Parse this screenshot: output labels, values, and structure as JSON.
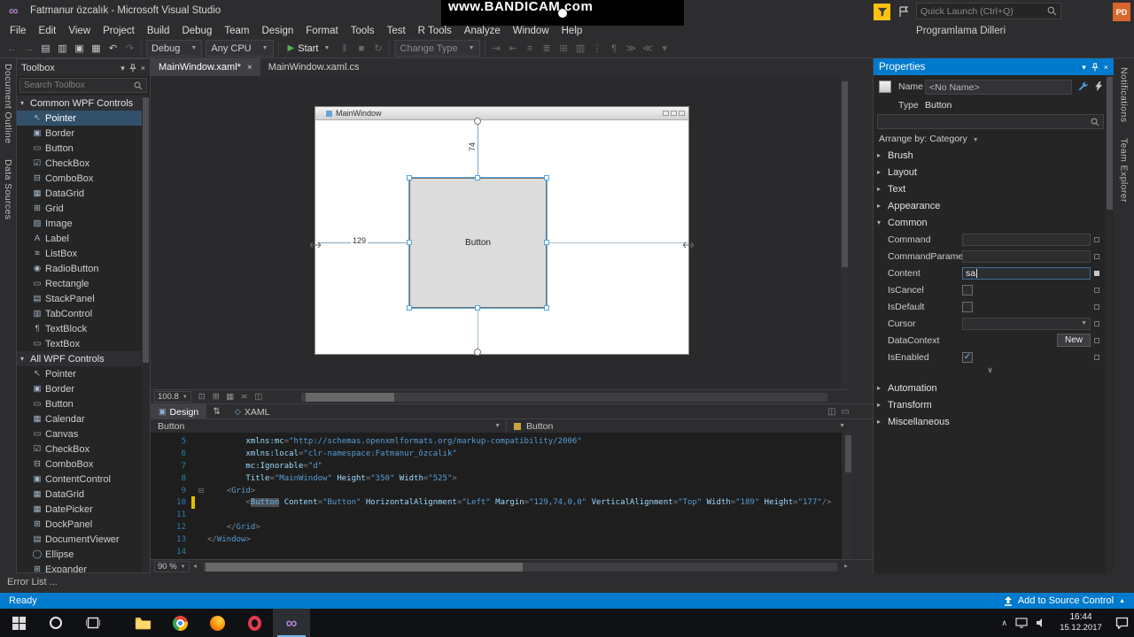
{
  "watermark": {
    "text": "www.BANDICAM.com"
  },
  "titlebar": {
    "title": "Fatmanur özcalık - Microsoft Visual Studio",
    "quick_launch_placeholder": "Quick Launch (Ctrl+Q)",
    "account_name": "Programlama Dilleri",
    "avatar_initials": "PD"
  },
  "menubar": {
    "items": [
      "File",
      "Edit",
      "View",
      "Project",
      "Build",
      "Debug",
      "Team",
      "Design",
      "Format",
      "Tools",
      "Test",
      "R Tools",
      "Analyze",
      "Window",
      "Help"
    ]
  },
  "toolbar": {
    "groups_a": [
      {
        "name": "nav-back-icon",
        "glyph": "←",
        "dim": true
      },
      {
        "name": "nav-forward-icon",
        "glyph": "→",
        "dim": true
      },
      {
        "name": "new-file-icon",
        "glyph": "▤",
        "dim": false
      },
      {
        "name": "open-file-icon",
        "glyph": "▥",
        "dim": false
      },
      {
        "name": "save-icon",
        "glyph": "▣",
        "dim": false
      },
      {
        "name": "save-all-icon",
        "glyph": "▦",
        "dim": false
      },
      {
        "name": "undo-icon",
        "glyph": "↶",
        "dim": false
      },
      {
        "name": "redo-icon",
        "glyph": "↷",
        "dim": true
      }
    ],
    "debug_target": "Debug",
    "platform": "Any CPU",
    "start_label": "Start",
    "groups_b": [
      {
        "name": "pause-icon",
        "glyph": "‖",
        "dim": true
      },
      {
        "name": "stop-icon",
        "glyph": "■",
        "dim": true
      },
      {
        "name": "restart-icon",
        "glyph": "↻",
        "dim": true
      }
    ],
    "change_type_label": "Change Type",
    "groups_c": [
      {
        "name": "step-into-icon",
        "glyph": "⇥",
        "dim": true
      },
      {
        "name": "step-out-icon",
        "glyph": "⇤",
        "dim": true
      },
      {
        "name": "align-lines-icon",
        "glyph": "≡",
        "dim": true
      },
      {
        "name": "align-blocks-icon",
        "glyph": "≣",
        "dim": true
      },
      {
        "name": "grid-toggle-icon",
        "glyph": "⊞",
        "dim": true
      },
      {
        "name": "columns-icon",
        "glyph": "▥",
        "dim": true
      },
      {
        "name": "list-members-icon",
        "glyph": "⋮",
        "dim": true
      },
      {
        "name": "comment-icon",
        "glyph": "¶",
        "dim": true
      },
      {
        "name": "indent-icon",
        "glyph": "≫",
        "dim": true
      },
      {
        "name": "outdent-icon",
        "glyph": "≪",
        "dim": true
      },
      {
        "name": "overflow-icon",
        "glyph": "▾",
        "dim": true
      }
    ]
  },
  "side_tabs_left": [
    "Document Outline",
    "Data Sources"
  ],
  "side_tabs_right": [
    "Notifications",
    "Team Explorer"
  ],
  "toolbox": {
    "title": "Toolbox",
    "search_placeholder": "Search Toolbox",
    "groups": [
      {
        "label": "Common WPF Controls",
        "items": [
          {
            "label": "Pointer",
            "icon": "↖",
            "selected": true
          },
          {
            "label": "Border",
            "icon": "▣"
          },
          {
            "label": "Button",
            "icon": "▭"
          },
          {
            "label": "CheckBox",
            "icon": "☑"
          },
          {
            "label": "ComboBox",
            "icon": "⊟"
          },
          {
            "label": "DataGrid",
            "icon": "▦"
          },
          {
            "label": "Grid",
            "icon": "⊞"
          },
          {
            "label": "Image",
            "icon": "▨"
          },
          {
            "label": "Label",
            "icon": "A"
          },
          {
            "label": "ListBox",
            "icon": "≡"
          },
          {
            "label": "RadioButton",
            "icon": "◉"
          },
          {
            "label": "Rectangle",
            "icon": "▭"
          },
          {
            "label": "StackPanel",
            "icon": "▤"
          },
          {
            "label": "TabControl",
            "icon": "▥"
          },
          {
            "label": "TextBlock",
            "icon": "¶"
          },
          {
            "label": "TextBox",
            "icon": "▭"
          }
        ]
      },
      {
        "label": "All WPF Controls",
        "items": [
          {
            "label": "Pointer",
            "icon": "↖"
          },
          {
            "label": "Border",
            "icon": "▣"
          },
          {
            "label": "Button",
            "icon": "▭"
          },
          {
            "label": "Calendar",
            "icon": "▦"
          },
          {
            "label": "Canvas",
            "icon": "▭"
          },
          {
            "label": "CheckBox",
            "icon": "☑"
          },
          {
            "label": "ComboBox",
            "icon": "⊟"
          },
          {
            "label": "ContentControl",
            "icon": "▣"
          },
          {
            "label": "DataGrid",
            "icon": "▦"
          },
          {
            "label": "DatePicker",
            "icon": "▦"
          },
          {
            "label": "DockPanel",
            "icon": "⊞"
          },
          {
            "label": "DocumentViewer",
            "icon": "▤"
          },
          {
            "label": "Ellipse",
            "icon": "◯"
          },
          {
            "label": "Expander",
            "icon": "⊞"
          }
        ]
      }
    ]
  },
  "doc_tabs": {
    "tab1": "MainWindow.xaml*",
    "tab2": "MainWindow.xaml.cs"
  },
  "designer": {
    "window_title": "MainWindow",
    "button_text": "Button",
    "dim_left": "129",
    "dim_top": "74",
    "zoom": "100.8",
    "bar_icons": [
      {
        "name": "zoom-fit-icon",
        "glyph": "⊡"
      },
      {
        "name": "show-grid-icon",
        "glyph": "⊞"
      },
      {
        "name": "snap-grid-icon",
        "glyph": "▦"
      },
      {
        "name": "snaplines-icon",
        "glyph": "≍"
      },
      {
        "name": "show-handles-icon",
        "glyph": "◫"
      }
    ]
  },
  "split": {
    "design": "Design",
    "xaml": "XAML"
  },
  "breadcrumb": {
    "left": "Button",
    "right": "Button"
  },
  "code": {
    "zoom": "90 %",
    "lines": [
      {
        "no": "5",
        "segs": [
          [
            "t",
            "        "
          ],
          [
            "a",
            "xmlns:mc"
          ],
          [
            "p",
            "="
          ],
          [
            "v",
            "\"http://schemas.openxmlformats.org/markup-compatibility/2006\""
          ]
        ]
      },
      {
        "no": "6",
        "segs": [
          [
            "t",
            "        "
          ],
          [
            "a",
            "xmlns:local"
          ],
          [
            "p",
            "="
          ],
          [
            "v",
            "\"clr-namespace:Fatmanur_özcalık\""
          ]
        ]
      },
      {
        "no": "7",
        "segs": [
          [
            "t",
            "        "
          ],
          [
            "a",
            "mc:Ignorable"
          ],
          [
            "p",
            "="
          ],
          [
            "v",
            "\"d\""
          ]
        ]
      },
      {
        "no": "8",
        "segs": [
          [
            "t",
            "        "
          ],
          [
            "a",
            "Title"
          ],
          [
            "p",
            "="
          ],
          [
            "v",
            "\"MainWindow\""
          ],
          [
            "t",
            " "
          ],
          [
            "a",
            "Height"
          ],
          [
            "p",
            "="
          ],
          [
            "v",
            "\"350\""
          ],
          [
            "t",
            " "
          ],
          [
            "a",
            "Width"
          ],
          [
            "p",
            "="
          ],
          [
            "v",
            "\"525\""
          ],
          [
            "p",
            ">"
          ]
        ]
      },
      {
        "no": "9",
        "fold": true,
        "segs": [
          [
            "t",
            "    "
          ],
          [
            "p",
            "<"
          ],
          [
            "e",
            "Grid"
          ],
          [
            "p",
            ">"
          ]
        ]
      },
      {
        "no": "10",
        "changed": true,
        "segs": [
          [
            "t",
            "        "
          ],
          [
            "p",
            "<"
          ],
          [
            "eh",
            "Button"
          ],
          [
            "t",
            " "
          ],
          [
            "a",
            "Content"
          ],
          [
            "p",
            "="
          ],
          [
            "v",
            "\"Button\""
          ],
          [
            "t",
            " "
          ],
          [
            "a",
            "HorizontalAlignment"
          ],
          [
            "p",
            "="
          ],
          [
            "v",
            "\"Left\""
          ],
          [
            "t",
            " "
          ],
          [
            "a",
            "Margin"
          ],
          [
            "p",
            "="
          ],
          [
            "v",
            "\"129,74,0,0\""
          ],
          [
            "t",
            " "
          ],
          [
            "a",
            "VerticalAlignment"
          ],
          [
            "p",
            "="
          ],
          [
            "v",
            "\"Top\""
          ],
          [
            "t",
            " "
          ],
          [
            "a",
            "Width"
          ],
          [
            "p",
            "="
          ],
          [
            "v",
            "\"189\""
          ],
          [
            "t",
            " "
          ],
          [
            "a",
            "Height"
          ],
          [
            "p",
            "="
          ],
          [
            "v",
            "\"177\""
          ],
          [
            "p",
            "/>"
          ]
        ]
      },
      {
        "no": "11",
        "segs": []
      },
      {
        "no": "12",
        "segs": [
          [
            "t",
            "    "
          ],
          [
            "p",
            "</"
          ],
          [
            "e",
            "Grid"
          ],
          [
            "p",
            ">"
          ]
        ]
      },
      {
        "no": "13",
        "segs": [
          [
            "p",
            "</"
          ],
          [
            "e",
            "Window"
          ],
          [
            "p",
            ">"
          ]
        ]
      },
      {
        "no": "14",
        "segs": []
      }
    ]
  },
  "properties": {
    "title": "Properties",
    "name_label": "Name",
    "name_value": "<No Name>",
    "type_label": "Type",
    "type_value": "Button",
    "arrange_label": "Arrange by: Category",
    "sections_top": [
      {
        "label": "Brush"
      },
      {
        "label": "Layout"
      },
      {
        "label": "Text"
      },
      {
        "label": "Appearance"
      }
    ],
    "common": {
      "label": "Common",
      "rows": [
        {
          "label": "Command",
          "control": "field",
          "value": ""
        },
        {
          "label": "CommandParame...",
          "control": "field",
          "value": ""
        },
        {
          "label": "Content",
          "control": "field",
          "value": "sa",
          "set": true,
          "editing": true
        },
        {
          "label": "IsCancel",
          "control": "checkbox",
          "checked": false
        },
        {
          "label": "IsDefault",
          "control": "checkbox",
          "checked": false
        },
        {
          "label": "Cursor",
          "control": "dropdown",
          "value": ""
        },
        {
          "label": "DataContext",
          "control": "button",
          "value": "New"
        },
        {
          "label": "IsEnabled",
          "control": "checkbox",
          "checked": true
        }
      ]
    },
    "sections_bottom": [
      {
        "label": "Automation"
      },
      {
        "label": "Transform"
      },
      {
        "label": "Miscellaneous"
      }
    ]
  },
  "error_list_label": "Error List ...",
  "statusbar": {
    "ready": "Ready",
    "source_control": "Add to Source Control"
  },
  "taskbar": {
    "time": "16:44",
    "date": "15.12.2017"
  }
}
